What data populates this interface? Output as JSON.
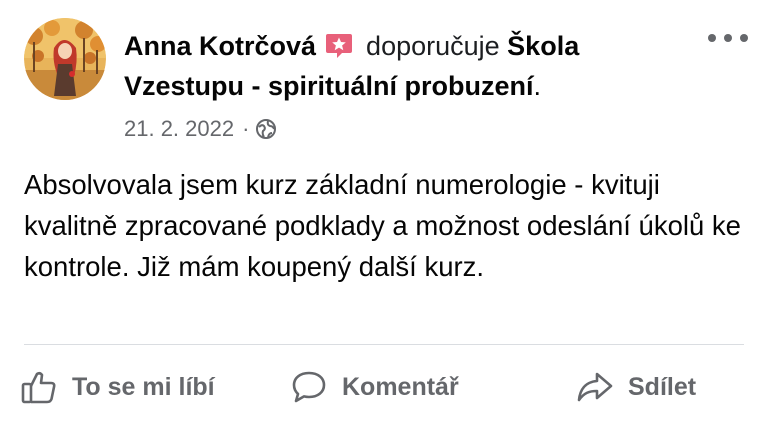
{
  "post": {
    "author": "Anna Kotrčová",
    "badge_icon": "star-badge-icon",
    "verb": "doporučuje",
    "page_name": "Škola Vzestupu - spirituální probuzení",
    "period": ".",
    "date": "21. 2. 2022",
    "separator": "·",
    "privacy_icon": "globe-icon",
    "text": "Absolvovala jsem kurz základní numerologie - kvituji kvalitně zpracované podklady a možnost odeslání úkolů ke kontrole. Již mám koupený další kurz."
  },
  "actions": {
    "like": "To se mi líbí",
    "comment": "Komentář",
    "share": "Sdílet"
  },
  "colors": {
    "text": "#050505",
    "secondary": "#65676b",
    "badge": "#e8607a",
    "divider": "#dadde1"
  }
}
